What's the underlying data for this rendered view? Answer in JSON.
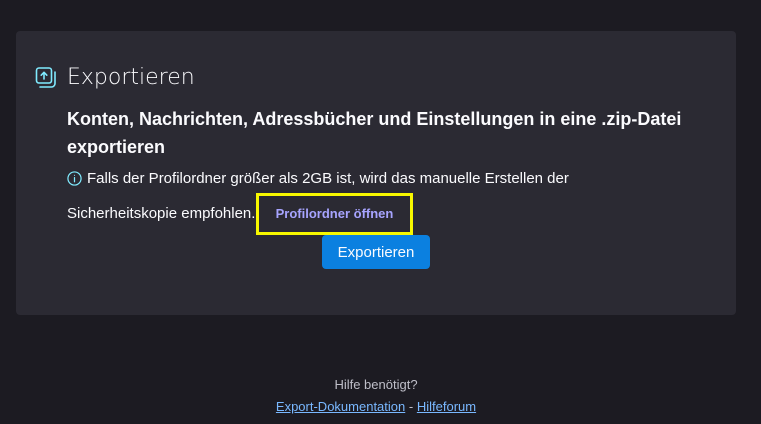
{
  "export": {
    "title": "Exportieren",
    "heading": "Konten, Nachrichten, Adressbücher und Einstellungen in eine .zip-Datei exportieren",
    "info_text": "Falls der Profilordner größer als 2GB ist, wird das manuelle Erstellen der Sicherheitskopie empfohlen.",
    "open_profile_label": "Profilordner öffnen",
    "export_button_label": "Exportieren"
  },
  "help": {
    "question": "Hilfe benötigt?",
    "documentation_link": "Export-Dokumentation",
    "separator": "-",
    "forum_link": "Hilfeforum"
  },
  "colors": {
    "background": "#1c1b22",
    "card": "#2b2a33",
    "accent_button": "#0b80e0",
    "link": "#a7a4ff",
    "help_link": "#79b8ff",
    "highlight": "#f8f800"
  },
  "icons": {
    "header": "export-upload-icon",
    "info": "info-circle-icon"
  }
}
